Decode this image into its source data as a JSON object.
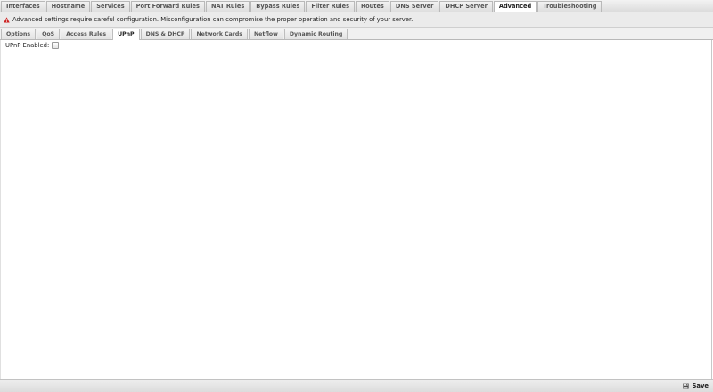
{
  "top_tabs": [
    {
      "label": "Interfaces"
    },
    {
      "label": "Hostname"
    },
    {
      "label": "Services"
    },
    {
      "label": "Port Forward Rules"
    },
    {
      "label": "NAT Rules"
    },
    {
      "label": "Bypass Rules"
    },
    {
      "label": "Filter Rules"
    },
    {
      "label": "Routes"
    },
    {
      "label": "DNS Server"
    },
    {
      "label": "DHCP Server"
    },
    {
      "label": "Advanced",
      "active": true
    },
    {
      "label": "Troubleshooting"
    }
  ],
  "warning": {
    "icon": "warning-triangle-icon",
    "text": "Advanced settings require careful configuration. Misconfiguration can compromise the proper operation and security of your server."
  },
  "sub_tabs": [
    {
      "label": "Options"
    },
    {
      "label": "QoS"
    },
    {
      "label": "Access Rules"
    },
    {
      "label": "UPnP",
      "active": true
    },
    {
      "label": "DNS & DHCP"
    },
    {
      "label": "Network Cards"
    },
    {
      "label": "Netflow"
    },
    {
      "label": "Dynamic Routing"
    }
  ],
  "upnp": {
    "label": "UPnP Enabled:",
    "checked": false
  },
  "toolbar": {
    "save_label": "Save",
    "save_icon": "floppy-disk-icon"
  },
  "colors": {
    "warning_icon": "#cc2222",
    "active_tab_bg": "#ffffff",
    "tabbar_bg": "#e4e4e4"
  }
}
